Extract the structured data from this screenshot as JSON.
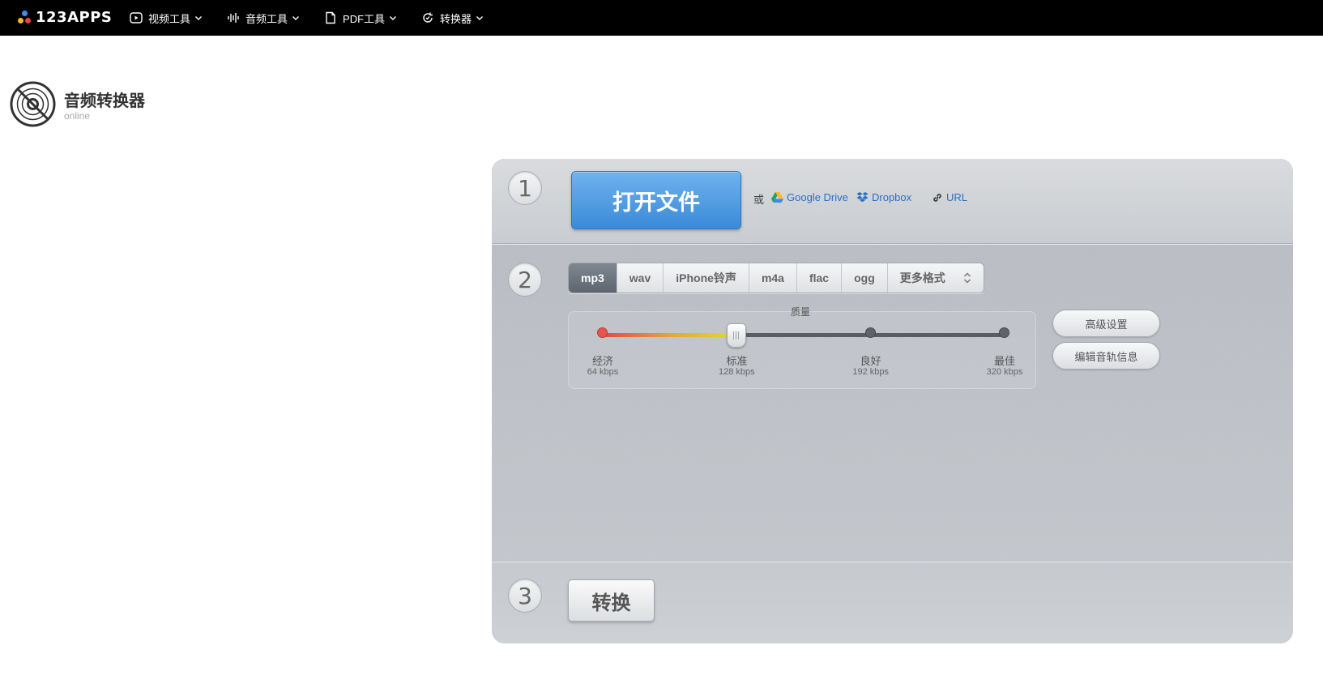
{
  "brand": {
    "name": "123APPS"
  },
  "nav": {
    "items": [
      {
        "label": "视频工具",
        "icon": "play-icon"
      },
      {
        "label": "音频工具",
        "icon": "waveform-icon"
      },
      {
        "label": "PDF工具",
        "icon": "document-icon"
      },
      {
        "label": "转换器",
        "icon": "convert-icon"
      }
    ]
  },
  "app": {
    "title": "音频转换器",
    "subtitle": "online",
    "icon": "disc-icon"
  },
  "step1": {
    "number": "1",
    "open_label": "打开文件",
    "or_label": "或",
    "sources": [
      {
        "label": "Google Drive",
        "icon": "google-drive-icon"
      },
      {
        "label": "Dropbox",
        "icon": "dropbox-icon"
      },
      {
        "label": "URL",
        "icon": "link-icon"
      }
    ]
  },
  "step2": {
    "number": "2",
    "formats": [
      "mp3",
      "wav",
      "iPhone铃声",
      "m4a",
      "flac",
      "ogg"
    ],
    "more_label": "更多格式",
    "selected_format": "mp3",
    "quality": {
      "label": "质量",
      "selected_index": 1,
      "levels": [
        {
          "name": "经济",
          "rate": "64 kbps"
        },
        {
          "name": "标准",
          "rate": "128 kbps"
        },
        {
          "name": "良好",
          "rate": "192 kbps"
        },
        {
          "name": "最佳",
          "rate": "320 kbps"
        }
      ]
    },
    "advanced_label": "高级设置",
    "edit_tags_label": "编辑音轨信息"
  },
  "step3": {
    "number": "3",
    "convert_label": "转换"
  },
  "colors": {
    "open_button": "#3a8ad8",
    "active_tab": "#5d656f",
    "link": "#2a6fc4"
  }
}
